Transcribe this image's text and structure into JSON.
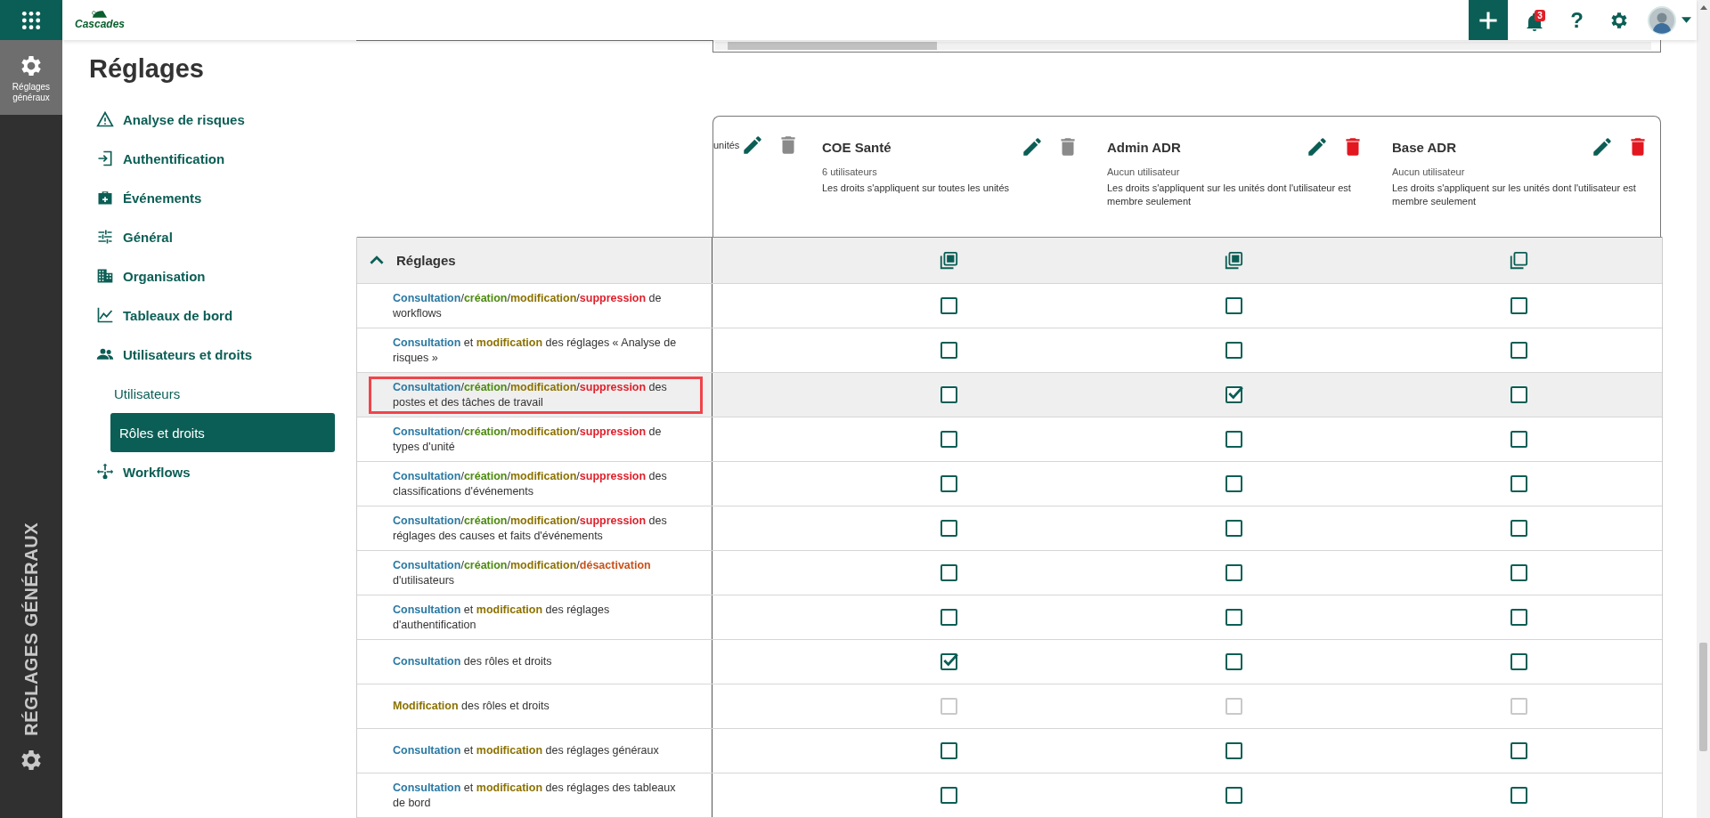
{
  "rail": {
    "items": [
      {
        "label": "Réglages généraux",
        "selected": true
      }
    ],
    "section_title": "RÉGLAGES GÉNÉRAUX"
  },
  "topbar": {
    "logo": "Cascades",
    "notifications_badge": "3",
    "help": "?"
  },
  "page_title": "Réglages",
  "nav": [
    {
      "label": "Analyse de risques",
      "kind": "warning"
    },
    {
      "label": "Authentification",
      "kind": "login"
    },
    {
      "label": "Événements",
      "kind": "medkit"
    },
    {
      "label": "Général",
      "kind": "sliders"
    },
    {
      "label": "Organisation",
      "kind": "building"
    },
    {
      "label": "Tableaux de bord",
      "kind": "chart"
    },
    {
      "label": "Utilisateurs et droits",
      "kind": "people",
      "children": [
        {
          "label": "Utilisateurs",
          "selected": false
        },
        {
          "label": "Rôles et droits",
          "selected": true
        }
      ]
    },
    {
      "label": "Workflows",
      "kind": "flow"
    }
  ],
  "roles": {
    "partial": {
      "scope": "unités",
      "deletable": false
    },
    "columns": [
      {
        "name": "COE Santé",
        "users": "6 utilisateurs",
        "scope": "Les droits s'appliquent sur toutes les unités",
        "deletable": false,
        "any_selected": true
      },
      {
        "name": "Admin ADR",
        "users": "Aucun utilisateur",
        "scope": "Les droits s'appliquent sur les unités dont l'utilisateur est membre seulement",
        "deletable": true,
        "any_selected": true
      },
      {
        "name": "Base ADR",
        "users": "Aucun utilisateur",
        "scope": "Les droits s'appliquent sur les unités dont l'utilisateur est membre seulement",
        "deletable": true,
        "any_selected": false
      }
    ]
  },
  "section": {
    "title": "Réglages",
    "expanded": true,
    "rows": [
      {
        "highlighted": false,
        "outlined": false,
        "parts": [
          {
            "text": "Consultation",
            "kind": "consult"
          },
          {
            "text": "/",
            "kind": "plain"
          },
          {
            "text": "création",
            "kind": "create"
          },
          {
            "text": "/",
            "kind": "plain"
          },
          {
            "text": "modification",
            "kind": "modify"
          },
          {
            "text": "/",
            "kind": "plain"
          },
          {
            "text": "suppression",
            "kind": "delete"
          },
          {
            "text": " de workflows",
            "kind": "plain"
          }
        ],
        "cells": [
          {
            "checked": false,
            "disabled": false
          },
          {
            "checked": false,
            "disabled": false
          },
          {
            "checked": false,
            "disabled": false
          }
        ]
      },
      {
        "highlighted": false,
        "outlined": false,
        "parts": [
          {
            "text": "Consultation",
            "kind": "consult"
          },
          {
            "text": " et ",
            "kind": "plain"
          },
          {
            "text": "modification",
            "kind": "modify"
          },
          {
            "text": " des réglages « Analyse de risques »",
            "kind": "plain"
          }
        ],
        "cells": [
          {
            "checked": false,
            "disabled": false
          },
          {
            "checked": false,
            "disabled": false
          },
          {
            "checked": false,
            "disabled": false
          }
        ]
      },
      {
        "highlighted": true,
        "outlined": true,
        "parts": [
          {
            "text": "Consultation",
            "kind": "consult"
          },
          {
            "text": "/",
            "kind": "plain"
          },
          {
            "text": "création",
            "kind": "create"
          },
          {
            "text": "/",
            "kind": "plain"
          },
          {
            "text": "modification",
            "kind": "modify"
          },
          {
            "text": "/",
            "kind": "plain"
          },
          {
            "text": "suppression",
            "kind": "delete"
          },
          {
            "text": " des postes et des tâches de travail",
            "kind": "plain"
          }
        ],
        "cells": [
          {
            "checked": false,
            "disabled": false
          },
          {
            "checked": true,
            "disabled": false
          },
          {
            "checked": false,
            "disabled": false
          }
        ]
      },
      {
        "highlighted": false,
        "outlined": false,
        "parts": [
          {
            "text": "Consultation",
            "kind": "consult"
          },
          {
            "text": "/",
            "kind": "plain"
          },
          {
            "text": "création",
            "kind": "create"
          },
          {
            "text": "/",
            "kind": "plain"
          },
          {
            "text": "modification",
            "kind": "modify"
          },
          {
            "text": "/",
            "kind": "plain"
          },
          {
            "text": "suppression",
            "kind": "delete"
          },
          {
            "text": " de types d'unité",
            "kind": "plain"
          }
        ],
        "cells": [
          {
            "checked": false,
            "disabled": false
          },
          {
            "checked": false,
            "disabled": false
          },
          {
            "checked": false,
            "disabled": false
          }
        ]
      },
      {
        "highlighted": false,
        "outlined": false,
        "parts": [
          {
            "text": "Consultation",
            "kind": "consult"
          },
          {
            "text": "/",
            "kind": "plain"
          },
          {
            "text": "création",
            "kind": "create"
          },
          {
            "text": "/",
            "kind": "plain"
          },
          {
            "text": "modification",
            "kind": "modify"
          },
          {
            "text": "/",
            "kind": "plain"
          },
          {
            "text": "suppression",
            "kind": "delete"
          },
          {
            "text": " des classifications d'événements",
            "kind": "plain"
          }
        ],
        "cells": [
          {
            "checked": false,
            "disabled": false
          },
          {
            "checked": false,
            "disabled": false
          },
          {
            "checked": false,
            "disabled": false
          }
        ]
      },
      {
        "highlighted": false,
        "outlined": false,
        "parts": [
          {
            "text": "Consultation",
            "kind": "consult"
          },
          {
            "text": "/",
            "kind": "plain"
          },
          {
            "text": "création",
            "kind": "create"
          },
          {
            "text": "/",
            "kind": "plain"
          },
          {
            "text": "modification",
            "kind": "modify"
          },
          {
            "text": "/",
            "kind": "plain"
          },
          {
            "text": "suppression",
            "kind": "delete"
          },
          {
            "text": " des réglages des causes et faits d'événements",
            "kind": "plain"
          }
        ],
        "cells": [
          {
            "checked": false,
            "disabled": false
          },
          {
            "checked": false,
            "disabled": false
          },
          {
            "checked": false,
            "disabled": false
          }
        ]
      },
      {
        "highlighted": false,
        "outlined": false,
        "parts": [
          {
            "text": "Consultation",
            "kind": "consult"
          },
          {
            "text": "/",
            "kind": "plain"
          },
          {
            "text": "création",
            "kind": "create"
          },
          {
            "text": "/",
            "kind": "plain"
          },
          {
            "text": "modification",
            "kind": "modify"
          },
          {
            "text": "/",
            "kind": "plain"
          },
          {
            "text": "désactivation",
            "kind": "deactivate"
          },
          {
            "text": " d'utilisateurs",
            "kind": "plain"
          }
        ],
        "cells": [
          {
            "checked": false,
            "disabled": false
          },
          {
            "checked": false,
            "disabled": false
          },
          {
            "checked": false,
            "disabled": false
          }
        ]
      },
      {
        "highlighted": false,
        "outlined": false,
        "parts": [
          {
            "text": "Consultation",
            "kind": "consult"
          },
          {
            "text": " et ",
            "kind": "plain"
          },
          {
            "text": "modification",
            "kind": "modify"
          },
          {
            "text": " des réglages d'authentification",
            "kind": "plain"
          }
        ],
        "cells": [
          {
            "checked": false,
            "disabled": false
          },
          {
            "checked": false,
            "disabled": false
          },
          {
            "checked": false,
            "disabled": false
          }
        ]
      },
      {
        "highlighted": false,
        "outlined": false,
        "parts": [
          {
            "text": "Consultation",
            "kind": "consult"
          },
          {
            "text": " des rôles et droits",
            "kind": "plain"
          }
        ],
        "cells": [
          {
            "checked": true,
            "disabled": false
          },
          {
            "checked": false,
            "disabled": false
          },
          {
            "checked": false,
            "disabled": false
          }
        ]
      },
      {
        "highlighted": false,
        "outlined": false,
        "parts": [
          {
            "text": "Modification",
            "kind": "modify"
          },
          {
            "text": " des rôles et droits",
            "kind": "plain"
          }
        ],
        "cells": [
          {
            "checked": false,
            "disabled": true
          },
          {
            "checked": false,
            "disabled": true
          },
          {
            "checked": false,
            "disabled": true
          }
        ]
      },
      {
        "highlighted": false,
        "outlined": false,
        "parts": [
          {
            "text": "Consultation",
            "kind": "consult"
          },
          {
            "text": " et ",
            "kind": "plain"
          },
          {
            "text": "modification",
            "kind": "modify"
          },
          {
            "text": " des réglages généraux",
            "kind": "plain"
          }
        ],
        "cells": [
          {
            "checked": false,
            "disabled": false
          },
          {
            "checked": false,
            "disabled": false
          },
          {
            "checked": false,
            "disabled": false
          }
        ]
      },
      {
        "highlighted": false,
        "outlined": false,
        "parts": [
          {
            "text": "Consultation",
            "kind": "consult"
          },
          {
            "text": " et ",
            "kind": "plain"
          },
          {
            "text": "modification",
            "kind": "modify"
          },
          {
            "text": " des réglages des tableaux de bord",
            "kind": "plain"
          }
        ],
        "cells": [
          {
            "checked": false,
            "disabled": false
          },
          {
            "checked": false,
            "disabled": false
          },
          {
            "checked": false,
            "disabled": false
          }
        ]
      }
    ]
  }
}
